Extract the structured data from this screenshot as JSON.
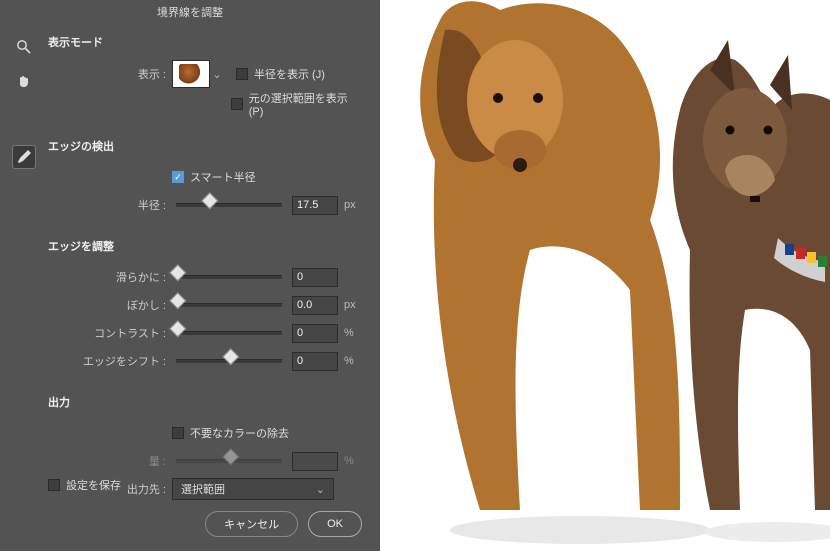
{
  "title": "境界線を調整",
  "view_mode": {
    "heading": "表示モード",
    "display_label": "表示 :",
    "show_radius": {
      "label": "半径を表示 (J)",
      "checked": false
    },
    "show_original": {
      "label": "元の選択範囲を表示 (P)",
      "checked": false
    }
  },
  "edge_detect": {
    "heading": "エッジの検出",
    "smart_radius": {
      "label": "スマート半径",
      "checked": true
    },
    "radius_label": "半径 :",
    "radius_value": "17.5",
    "radius_unit": "px",
    "radius_pct": 30
  },
  "adjust": {
    "heading": "エッジを調整",
    "smooth_label": "滑らかに :",
    "smooth_value": "0",
    "smooth_pct": 0,
    "feather_label": "ぼかし :",
    "feather_value": "0.0",
    "feather_unit": "px",
    "feather_pct": 0,
    "contrast_label": "コントラスト :",
    "contrast_value": "0",
    "contrast_unit": "%",
    "contrast_pct": 0,
    "shift_label": "エッジをシフト :",
    "shift_value": "0",
    "shift_unit": "%",
    "shift_pct": 50
  },
  "output": {
    "heading": "出力",
    "decon": {
      "label": "不要なカラーの除去",
      "checked": false
    },
    "amount_label": "量 :",
    "amount_unit": "%",
    "amount_pct": 50,
    "to_label": "出力先 :",
    "to_value": "選択範囲"
  },
  "remember": {
    "label": "設定を保存",
    "checked": false
  },
  "buttons": {
    "cancel": "キャンセル",
    "ok": "OK"
  }
}
